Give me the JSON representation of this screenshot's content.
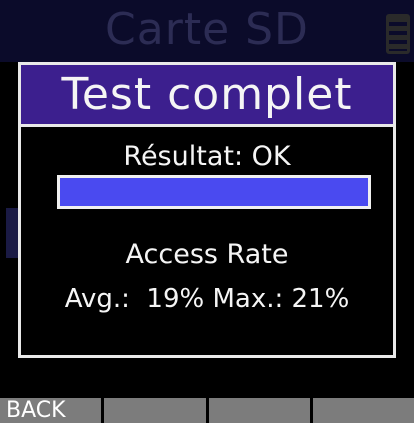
{
  "background_screen": {
    "title": "Carte SD"
  },
  "dialog": {
    "title": "Test complet",
    "result": "Résultat: OK",
    "progress": 1.0,
    "access_rate_label": "Access Rate",
    "access_rate_values": "Avg.:  19% Max.: 21%"
  },
  "softkeys": {
    "labels": [
      "BACK",
      "",
      "",
      ""
    ]
  },
  "colors": {
    "dialog_header": "#3c1f8e",
    "progress_fill": "#4a4af0",
    "softkey_bg": "#7c7c7c"
  }
}
